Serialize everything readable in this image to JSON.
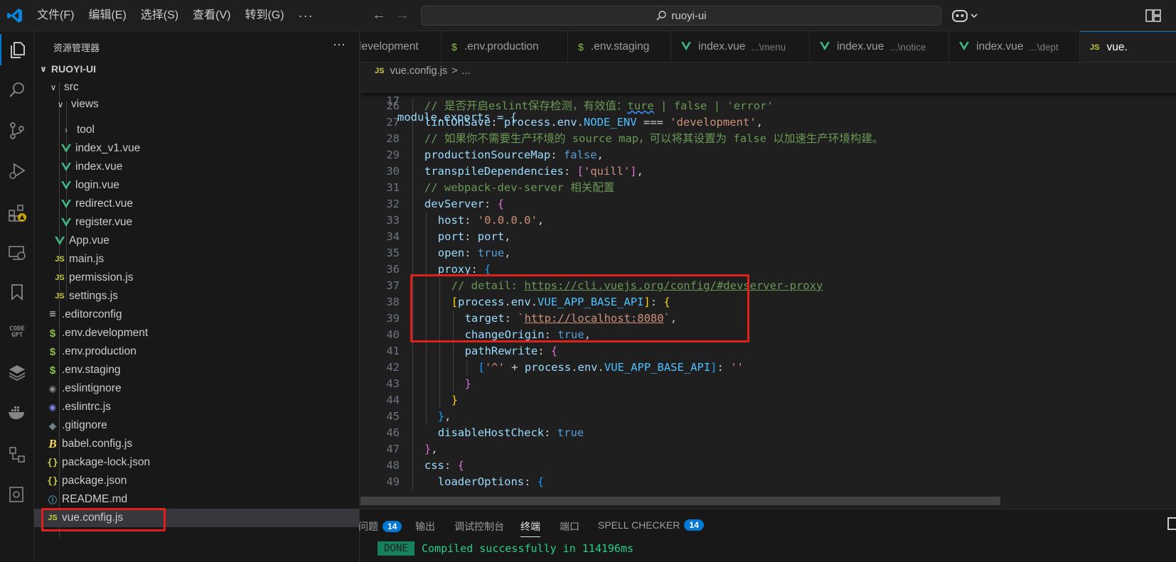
{
  "titlebar": {
    "menu": [
      "文件(F)",
      "编辑(E)",
      "选择(S)",
      "查看(V)",
      "转到(G)",
      "···"
    ],
    "search_text": "ruoyi-ui"
  },
  "explorer": {
    "title": "资源管理器",
    "more": "···",
    "items": [
      {
        "label": "RUOYI-UI",
        "kind": "folder-open"
      },
      {
        "label": "src",
        "kind": "folder-open"
      },
      {
        "label": "views",
        "kind": "folder-open"
      },
      {
        "label": "tool",
        "kind": "folder-closed"
      },
      {
        "label": "index_v1.vue",
        "kind": "vue"
      },
      {
        "label": "index.vue",
        "kind": "vue"
      },
      {
        "label": "login.vue",
        "kind": "vue"
      },
      {
        "label": "redirect.vue",
        "kind": "vue"
      },
      {
        "label": "register.vue",
        "kind": "vue"
      },
      {
        "label": "App.vue",
        "kind": "vue"
      },
      {
        "label": "main.js",
        "kind": "js"
      },
      {
        "label": "permission.js",
        "kind": "js"
      },
      {
        "label": "settings.js",
        "kind": "js"
      },
      {
        "label": ".editorconfig",
        "kind": "config"
      },
      {
        "label": ".env.development",
        "kind": "env"
      },
      {
        "label": ".env.production",
        "kind": "env"
      },
      {
        "label": ".env.staging",
        "kind": "env"
      },
      {
        "label": ".eslintignore",
        "kind": "eslint"
      },
      {
        "label": ".eslintrc.js",
        "kind": "eslintrc"
      },
      {
        "label": ".gitignore",
        "kind": "git"
      },
      {
        "label": "babel.config.js",
        "kind": "babel"
      },
      {
        "label": "package-lock.json",
        "kind": "json"
      },
      {
        "label": "package.json",
        "kind": "json"
      },
      {
        "label": "README.md",
        "kind": "info"
      },
      {
        "label": "vue.config.js",
        "kind": "js",
        "selected": true
      }
    ]
  },
  "tabs": [
    {
      "label": "v.development",
      "desc": "",
      "icon": ""
    },
    {
      "label": ".env.production",
      "desc": "",
      "icon": "$"
    },
    {
      "label": ".env.staging",
      "desc": "",
      "icon": "$"
    },
    {
      "label": "index.vue",
      "desc": "...\\menu",
      "icon": "vue"
    },
    {
      "label": "index.vue",
      "desc": "...\\notice",
      "icon": "vue"
    },
    {
      "label": "index.vue",
      "desc": "...\\dept",
      "icon": "vue"
    },
    {
      "label": "vue.",
      "desc": "",
      "icon": "JS",
      "active": true
    }
  ],
  "breadcrumb": {
    "file": "vue.config.js",
    "sep": ">",
    "rest": "..."
  },
  "editor": {
    "sticky_line": {
      "n": "17",
      "text": "module.exports = {"
    },
    "line_numbers": [
      "26",
      "27",
      "28",
      "29",
      "30",
      "31",
      "32",
      "33",
      "34",
      "35",
      "36",
      "37",
      "38",
      "39",
      "40",
      "41",
      "42",
      "43",
      "44",
      "45",
      "46",
      "47",
      "48",
      "49"
    ],
    "lines": [
      {
        "i": 2,
        "parts": [
          [
            "c-com",
            "// 是否开启eslint保存检测，有效值："
          ],
          [
            "c-com c-squig",
            "ture"
          ],
          [
            "c-com",
            " | false | 'error'"
          ]
        ]
      },
      {
        "i": 2,
        "parts": [
          [
            "c-prop",
            "lintOnSave"
          ],
          [
            "c-pun",
            ": "
          ],
          [
            "c-var",
            "process"
          ],
          [
            "c-pun",
            "."
          ],
          [
            "c-var",
            "env"
          ],
          [
            "c-pun",
            "."
          ],
          [
            "c-const",
            "NODE_ENV"
          ],
          [
            "c-pun",
            " === "
          ],
          [
            "c-str",
            "'development'"
          ],
          [
            "c-pun",
            ","
          ]
        ]
      },
      {
        "i": 2,
        "parts": [
          [
            "c-com",
            "// 如果你不需要生产环境的 source map，可以将其设置为 false 以加速生产环境构建。"
          ]
        ]
      },
      {
        "i": 2,
        "parts": [
          [
            "c-prop",
            "productionSourceMap"
          ],
          [
            "c-pun",
            ": "
          ],
          [
            "c-kw",
            "false"
          ],
          [
            "c-pun",
            ","
          ]
        ]
      },
      {
        "i": 2,
        "parts": [
          [
            "c-prop",
            "transpileDependencies"
          ],
          [
            "c-pun",
            ": "
          ],
          [
            "c-b2",
            "["
          ],
          [
            "c-str",
            "'quill'"
          ],
          [
            "c-b2",
            "]"
          ],
          [
            "c-pun",
            ","
          ]
        ]
      },
      {
        "i": 2,
        "parts": [
          [
            "c-com",
            "// webpack-dev-server 相关配置"
          ]
        ]
      },
      {
        "i": 2,
        "parts": [
          [
            "c-prop",
            "devServer"
          ],
          [
            "c-pun",
            ": "
          ],
          [
            "c-b2",
            "{"
          ]
        ]
      },
      {
        "i": 4,
        "parts": [
          [
            "c-prop",
            "host"
          ],
          [
            "c-pun",
            ": "
          ],
          [
            "c-str",
            "'0.0.0.0'"
          ],
          [
            "c-pun",
            ","
          ]
        ]
      },
      {
        "i": 4,
        "parts": [
          [
            "c-prop",
            "port"
          ],
          [
            "c-pun",
            ": "
          ],
          [
            "c-var",
            "port"
          ],
          [
            "c-pun",
            ","
          ]
        ]
      },
      {
        "i": 4,
        "parts": [
          [
            "c-prop",
            "open"
          ],
          [
            "c-pun",
            ": "
          ],
          [
            "c-kw",
            "true"
          ],
          [
            "c-pun",
            ","
          ]
        ]
      },
      {
        "i": 4,
        "parts": [
          [
            "c-prop",
            "proxy"
          ],
          [
            "c-pun",
            ": "
          ],
          [
            "c-b3",
            "{"
          ]
        ]
      },
      {
        "i": 6,
        "parts": [
          [
            "c-com",
            "// detail: "
          ],
          [
            "c-com c-link",
            "https://cli.vuejs.org/config/#devserver-proxy"
          ]
        ]
      },
      {
        "i": 6,
        "parts": [
          [
            "c-b1",
            "["
          ],
          [
            "c-var",
            "process"
          ],
          [
            "c-pun",
            "."
          ],
          [
            "c-var",
            "env"
          ],
          [
            "c-pun",
            "."
          ],
          [
            "c-const",
            "VUE_APP_BASE_API"
          ],
          [
            "c-b1",
            "]"
          ],
          [
            "c-pun",
            ": "
          ],
          [
            "c-b1",
            "{"
          ]
        ]
      },
      {
        "i": 8,
        "parts": [
          [
            "c-prop",
            "target"
          ],
          [
            "c-pun",
            ": "
          ],
          [
            "c-str",
            "`"
          ],
          [
            "c-str c-link",
            "http://localhost:8080"
          ],
          [
            "c-str",
            "`"
          ],
          [
            "c-pun",
            ","
          ]
        ]
      },
      {
        "i": 8,
        "parts": [
          [
            "c-prop",
            "changeOrigin"
          ],
          [
            "c-pun",
            ": "
          ],
          [
            "c-kw",
            "true"
          ],
          [
            "c-pun",
            ","
          ]
        ]
      },
      {
        "i": 8,
        "parts": [
          [
            "c-prop",
            "pathRewrite"
          ],
          [
            "c-pun",
            ": "
          ],
          [
            "c-b2",
            "{"
          ]
        ]
      },
      {
        "i": 10,
        "parts": [
          [
            "c-b3",
            "["
          ],
          [
            "c-str",
            "'^'"
          ],
          [
            "c-pun",
            " + "
          ],
          [
            "c-var",
            "process"
          ],
          [
            "c-pun",
            "."
          ],
          [
            "c-var",
            "env"
          ],
          [
            "c-pun",
            "."
          ],
          [
            "c-const",
            "VUE_APP_BASE_API"
          ],
          [
            "c-b3",
            "]"
          ],
          [
            "c-pun",
            ": "
          ],
          [
            "c-str",
            "''"
          ]
        ]
      },
      {
        "i": 8,
        "parts": [
          [
            "c-b2",
            "}"
          ]
        ]
      },
      {
        "i": 6,
        "parts": [
          [
            "c-b1",
            "}"
          ]
        ]
      },
      {
        "i": 4,
        "parts": [
          [
            "c-b3",
            "}"
          ],
          [
            "c-pun",
            ","
          ]
        ]
      },
      {
        "i": 4,
        "parts": [
          [
            "c-prop",
            "disableHostCheck"
          ],
          [
            "c-pun",
            ": "
          ],
          [
            "c-kw",
            "true"
          ]
        ]
      },
      {
        "i": 2,
        "parts": [
          [
            "c-b2",
            "}"
          ],
          [
            "c-pun",
            ","
          ]
        ]
      },
      {
        "i": 2,
        "parts": [
          [
            "c-prop",
            "css"
          ],
          [
            "c-pun",
            ": "
          ],
          [
            "c-b2",
            "{"
          ]
        ]
      },
      {
        "i": 4,
        "parts": [
          [
            "c-prop",
            "loaderOptions"
          ],
          [
            "c-pun",
            ": "
          ],
          [
            "c-b3",
            "{"
          ]
        ]
      }
    ]
  },
  "panel": {
    "tabs": [
      {
        "label": "问题",
        "badge": "14"
      },
      {
        "label": "输出",
        "badge": ""
      },
      {
        "label": "调试控制台",
        "badge": ""
      },
      {
        "label": "终端",
        "badge": "",
        "active": true
      },
      {
        "label": "端口",
        "badge": ""
      },
      {
        "label": "SPELL CHECKER",
        "badge": "14"
      }
    ],
    "done": "DONE",
    "terminal_line": "Compiled successfully in 114196ms"
  },
  "activitybar": {
    "codegpt_label": "CODE GPT"
  },
  "colors": {
    "accent": "#0078d4",
    "highlight_box": "#e0201b",
    "terminal_green": "#23d18b",
    "done_bg": "#16825d"
  }
}
